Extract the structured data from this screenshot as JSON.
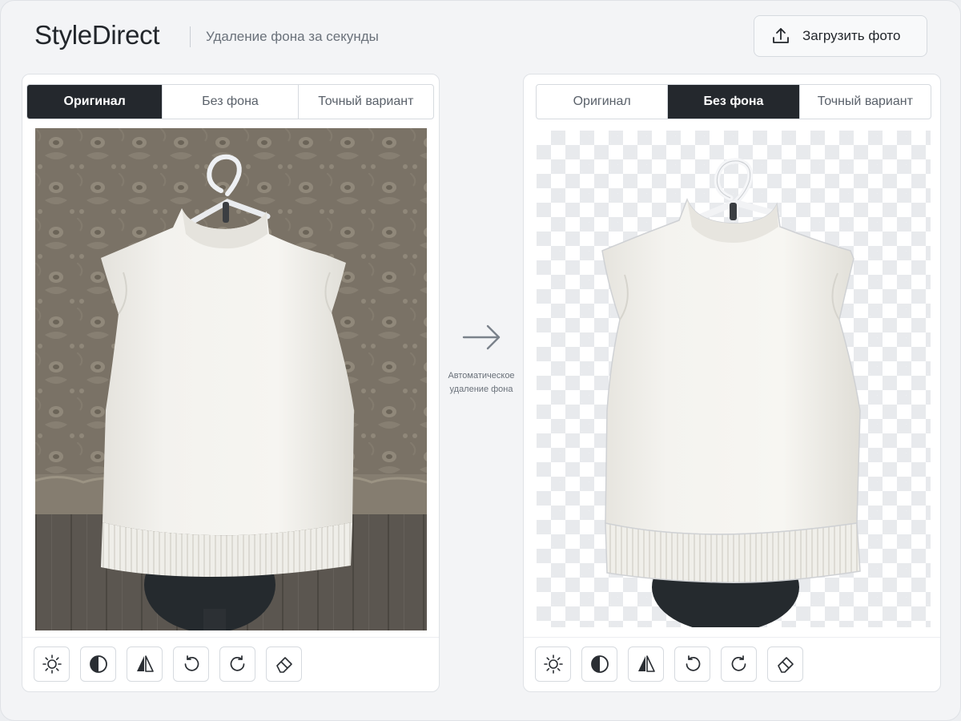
{
  "header": {
    "brand": "StyleDirect",
    "tagline": "Удаление фона за секунды",
    "upload_label": "Загрузить фото"
  },
  "left_panel": {
    "tabs": [
      {
        "label": "Оригинал",
        "active": true
      },
      {
        "label": "Без фона",
        "active": false
      },
      {
        "label": "Точный вариант",
        "active": false
      }
    ]
  },
  "right_panel": {
    "tabs": [
      {
        "label": "Оригинал",
        "active": false
      },
      {
        "label": "Без фона",
        "active": true
      },
      {
        "label": "Точный вариант",
        "active": false
      }
    ]
  },
  "middle": {
    "caption_line1": "Автоматическое",
    "caption_line2": "удаление фона"
  },
  "toolbar_icons": [
    "brightness-icon",
    "contrast-icon",
    "flip-icon",
    "rotate-left-icon",
    "rotate-right-icon",
    "eraser-icon"
  ],
  "colors": {
    "accent_dark": "#24282d",
    "wallpaper": "#7d7568",
    "garment": "#f2f1ec",
    "mannequin": "#252a2e"
  }
}
